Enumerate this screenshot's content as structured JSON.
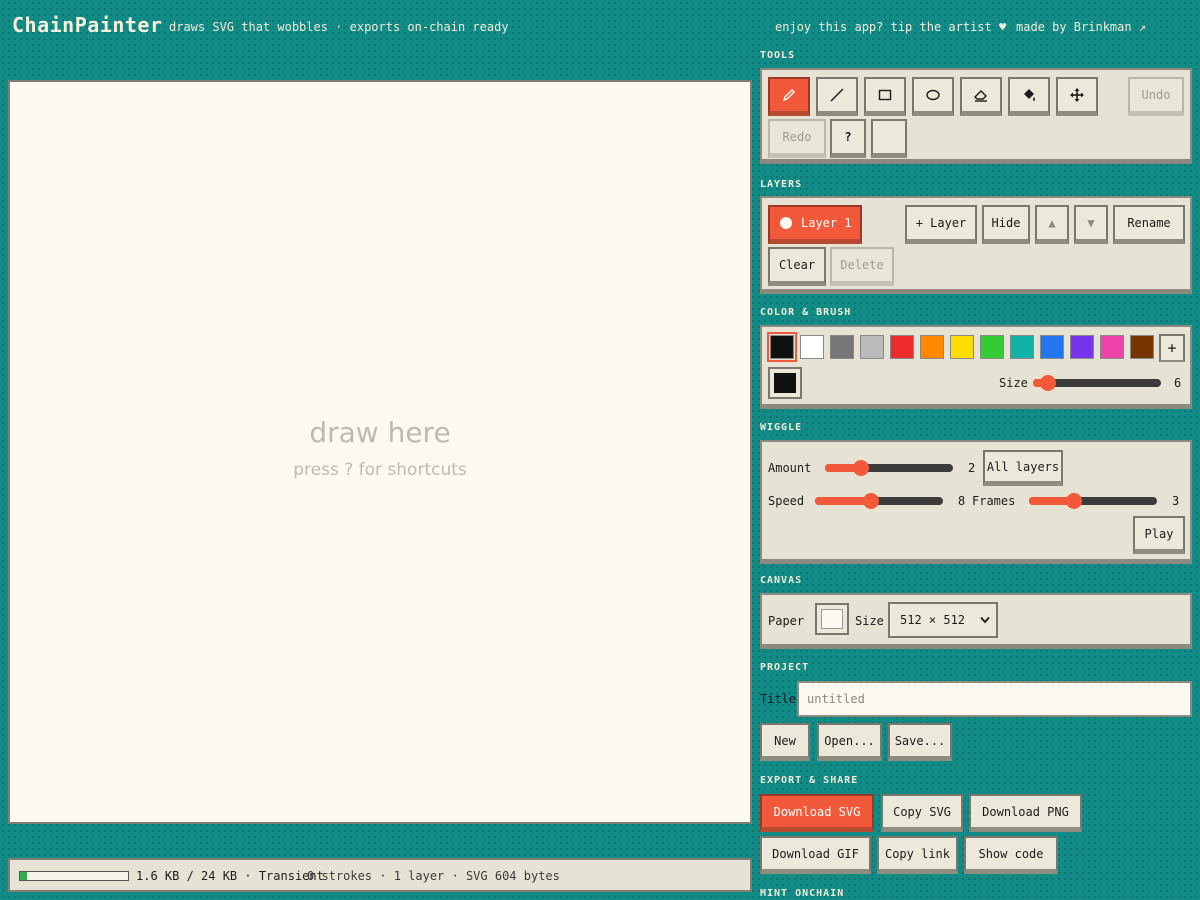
{
  "header": {
    "title": "ChainPainter",
    "tagline": "draws SVG that wobbles · exports on-chain ready",
    "tip": "enjoy this app? tip the artist ♥",
    "made_by": "made by Brinkman ↗"
  },
  "canvas": {
    "hint": "draw here",
    "subhint": "press ? for shortcuts",
    "background": "#fbf9f1"
  },
  "status": {
    "storage": "1.6 KB / 24 KB · Transient",
    "storage_fill": 0.067,
    "stats": "0 strokes · 1 layer · SVG 604 bytes"
  },
  "tools": {
    "label": "TOOLS",
    "items": [
      {
        "name": "pencil",
        "icon": "pencil-icon",
        "active": true
      },
      {
        "name": "line",
        "icon": "line-icon"
      },
      {
        "name": "rectangle",
        "icon": "rectangle-icon"
      },
      {
        "name": "ellipse",
        "icon": "ellipse-icon"
      },
      {
        "name": "eraser",
        "icon": "eraser-icon"
      },
      {
        "name": "fill",
        "icon": "paint-bucket-icon"
      },
      {
        "name": "move",
        "icon": "move-icon"
      }
    ],
    "undo": "Undo",
    "redo": "Redo",
    "help": "?"
  },
  "layers": {
    "label": "LAYERS",
    "current": "Layer 1",
    "add": "+ Layer",
    "hide": "Hide",
    "up": "▲",
    "down": "▼",
    "rename": "Rename",
    "clear": "Clear",
    "delete": "Delete"
  },
  "color": {
    "label": "COLOR & BRUSH",
    "swatches": [
      "#111111",
      "#ffffff",
      "#777777",
      "#bbbbbb",
      "#ee2b2b",
      "#ff8800",
      "#ffdd00",
      "#33cc33",
      "#11b3a6",
      "#2277ee",
      "#7733ee",
      "#ee44aa",
      "#773300"
    ],
    "selected": "#111111",
    "add": "+",
    "size_label": "Size",
    "size_value": "6",
    "size_fraction": 0.12
  },
  "wiggle": {
    "label": "WIGGLE",
    "amount_label": "Amount",
    "amount_value": "2",
    "amount_fraction": 0.28,
    "all_layers": "All layers",
    "speed_label": "Speed",
    "speed_value": "8",
    "speed_fraction": 0.44,
    "frames_label": "Frames",
    "frames_value": "3",
    "frames_fraction": 0.35,
    "play": "Play"
  },
  "canvas_settings": {
    "label": "CANVAS",
    "paper_label": "Paper",
    "paper_color": "#fbf9f1",
    "size_label": "Size",
    "size_value": "512 × 512",
    "size_options": [
      "512 × 512"
    ]
  },
  "project": {
    "label": "PROJECT",
    "title_label": "Title",
    "title_placeholder": "untitled",
    "new": "New",
    "open": "Open...",
    "save": "Save..."
  },
  "export": {
    "label": "EXPORT & SHARE",
    "download_svg": "Download SVG",
    "copy_svg": "Copy SVG",
    "download_png": "Download PNG",
    "download_gif": "Download GIF",
    "copy_link": "Copy link",
    "show_code": "Show code"
  },
  "mint": {
    "label": "MINT ONCHAIN"
  },
  "colors": {
    "background": "#128a86",
    "accent": "#f2593a",
    "panel": "#e6e2d4"
  }
}
